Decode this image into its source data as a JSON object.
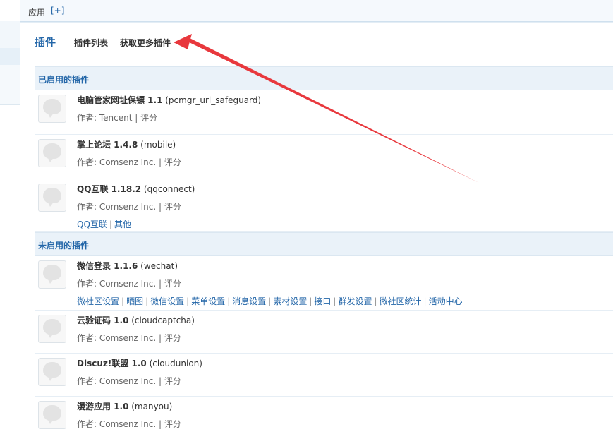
{
  "topbar": {
    "label": "应用",
    "add": "[+]"
  },
  "nav": {
    "title": "插件",
    "list_link": "插件列表",
    "more_link": "获取更多插件"
  },
  "sections": {
    "enabled": "已启用的插件",
    "disabled": "未启用的插件"
  },
  "plugins": [
    {
      "name": "电脑管家网址保镖 1.1",
      "id": " (pcmgr_url_safeguard)",
      "author": "作者: Tencent",
      "rate": "评分",
      "links": []
    },
    {
      "name": "掌上论坛 1.4.8",
      "id": " (mobile)",
      "author": "作者: Comsenz Inc.",
      "rate": "评分",
      "links": []
    },
    {
      "name": "QQ互联 1.18.2",
      "id": " (qqconnect)",
      "author": "作者: Comsenz Inc.",
      "rate": "评分",
      "links": [
        "QQ互联",
        "其他"
      ]
    },
    {
      "name": "微信登录 1.1.6",
      "id": " (wechat)",
      "author": "作者: Comsenz Inc.",
      "rate": "评分",
      "links": [
        "微社区设置",
        "晒图",
        "微信设置",
        "菜单设置",
        "消息设置",
        "素材设置",
        "接口",
        "群发设置",
        "微社区统计",
        "活动中心"
      ]
    },
    {
      "name": "云验证码 1.0",
      "id": " (cloudcaptcha)",
      "author": "作者: Comsenz Inc.",
      "rate": "评分",
      "links": []
    },
    {
      "name": "Discuz!联盟 1.0",
      "id": " (cloudunion)",
      "author": "作者: Comsenz Inc.",
      "rate": "评分",
      "links": []
    },
    {
      "name": "漫游应用 1.0",
      "id": " (manyou)",
      "author": "作者: Comsenz Inc.",
      "rate": "评分",
      "links": []
    }
  ],
  "separator": "|",
  "colors": {
    "link": "#2366a8",
    "section_bg": "#eaf2f9",
    "arrow": "#e8383d"
  }
}
